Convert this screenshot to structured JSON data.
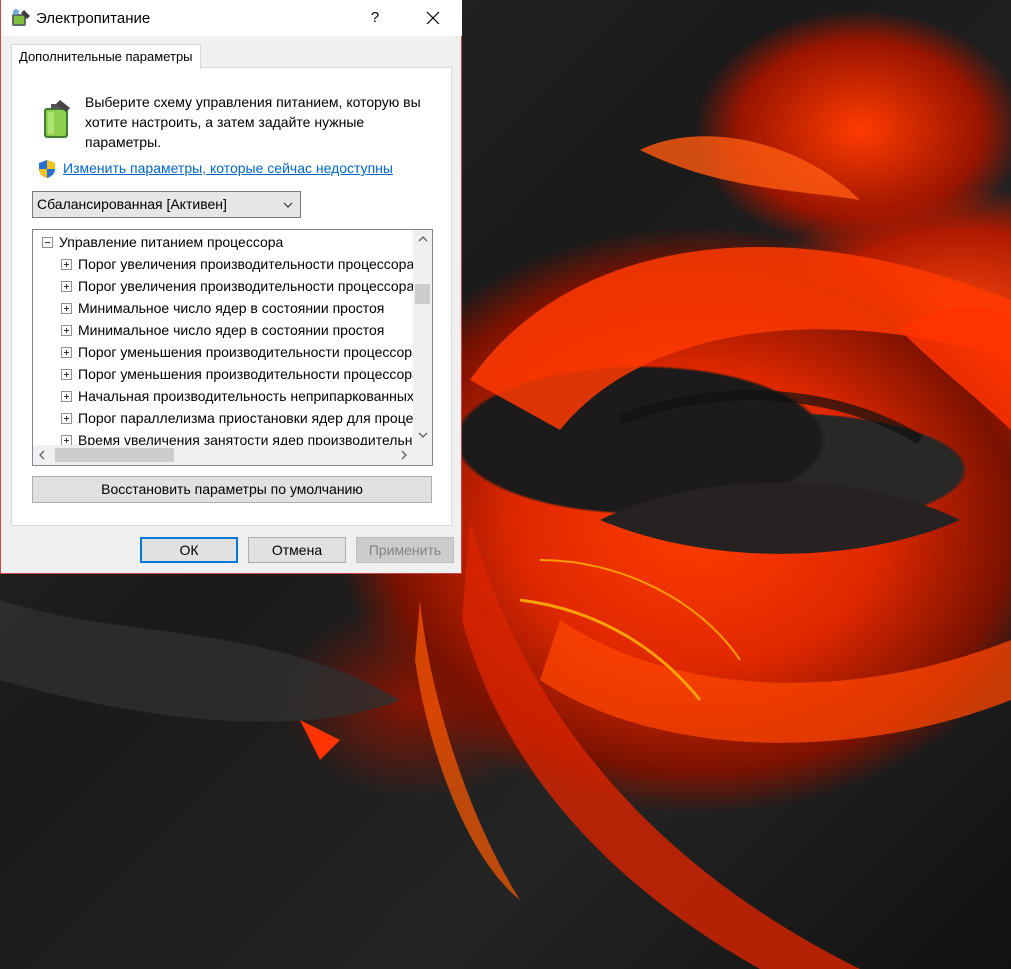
{
  "window": {
    "title": "Электропитание",
    "help_label": "?",
    "close_icon": "close-icon"
  },
  "tab": {
    "label": "Дополнительные параметры"
  },
  "description": "Выберите схему управления питанием, которую вы хотите настроить, а затем задайте нужные параметры.",
  "change_link": "Изменить параметры, которые сейчас недоступны",
  "plan_select": {
    "value": "Сбалансированная [Активен]"
  },
  "tree": {
    "root": "Управление питанием процессора",
    "items": [
      "Порог увеличения производительности процессора",
      "Порог увеличения производительности процессора",
      "Минимальное число ядер в состоянии простоя",
      "Минимальное число ядер в состоянии простоя",
      "Порог уменьшения производительности процессора",
      "Порог уменьшения производительности процессора",
      "Начальная производительность неприпаркованных ядер",
      "Порог параллелизма приостановки ядер для процессора",
      "Время увеличения занятости ядер производительности"
    ]
  },
  "buttons": {
    "restore": "Восстановить параметры по умолчанию",
    "ok": "ОК",
    "cancel": "Отмена",
    "apply": "Применить"
  },
  "colors": {
    "link": "#0066cc",
    "ok_border": "#0078d7",
    "window_border": "#cc4444"
  }
}
